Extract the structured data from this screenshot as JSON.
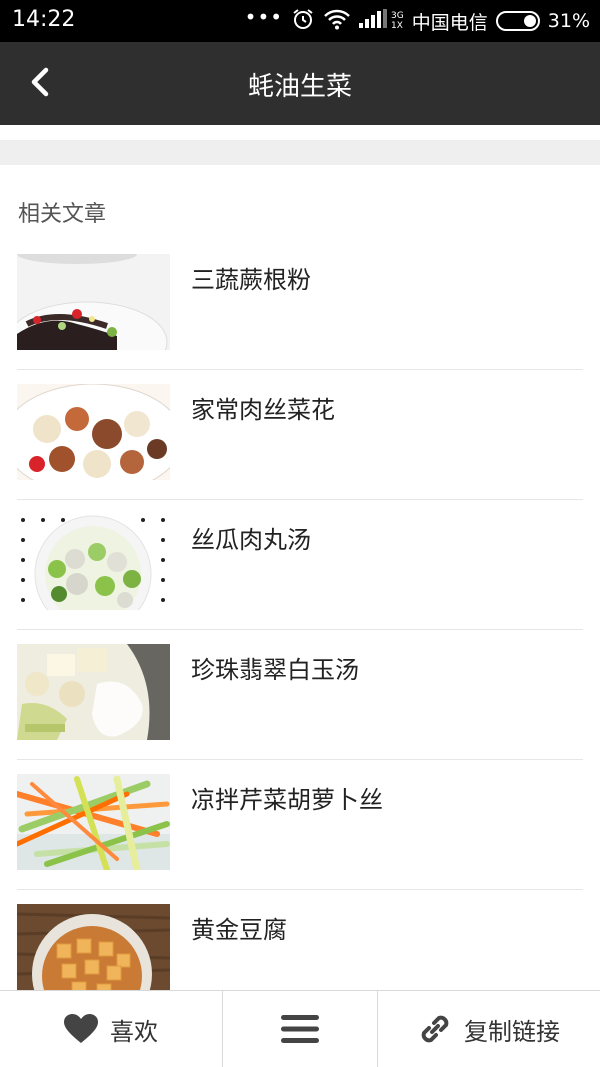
{
  "status_bar": {
    "time": "14:22",
    "dots": "•••",
    "signal_type_top": "3G",
    "signal_type_bottom": "1X",
    "carrier": "中国电信",
    "battery": "31%"
  },
  "header": {
    "title": "蚝油生菜",
    "back_icon": "chevron-left-icon"
  },
  "related": {
    "section_title": "相关文章",
    "items": [
      {
        "title": "三蔬蕨根粉"
      },
      {
        "title": "家常肉丝菜花"
      },
      {
        "title": "丝瓜肉丸汤"
      },
      {
        "title": "珍珠翡翠白玉汤"
      },
      {
        "title": "凉拌芹菜胡萝卜丝"
      },
      {
        "title": "黄金豆腐"
      }
    ]
  },
  "toolbar": {
    "like_label": "喜欢",
    "like_icon": "heart-icon",
    "menu_icon": "menu-icon",
    "copy_label": "复制链接",
    "copy_icon": "link-icon"
  },
  "colors": {
    "status_bg": "#000000",
    "nav_bg": "#2f2f2f",
    "separator": "#efefef",
    "text_dark": "#222222",
    "text_muted": "#555555"
  }
}
